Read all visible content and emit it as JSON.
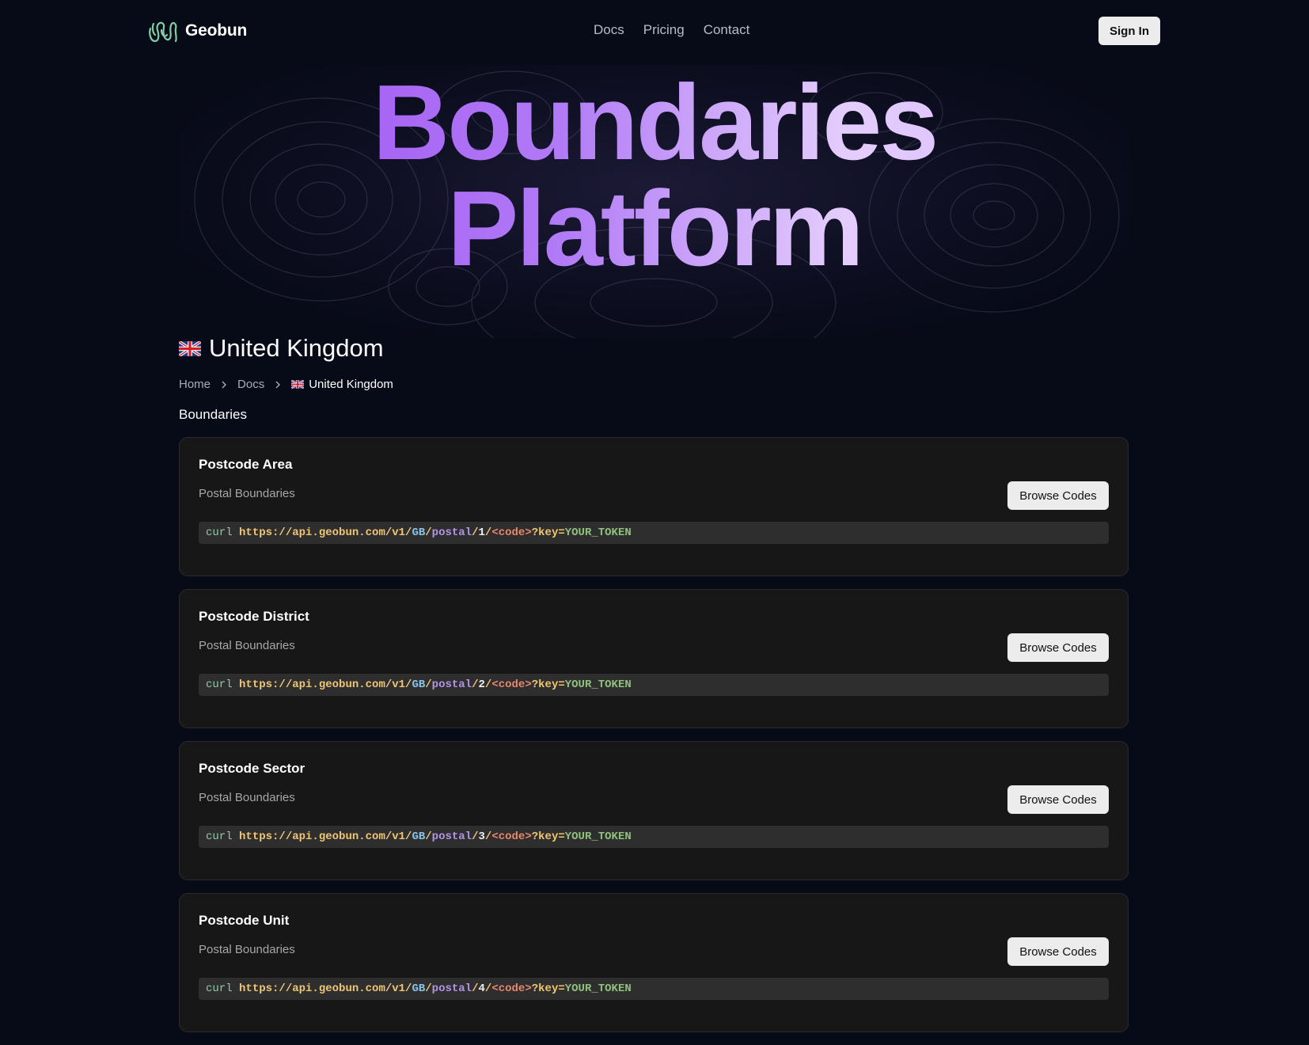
{
  "nav": {
    "brand": "Geobun",
    "links": [
      "Docs",
      "Pricing",
      "Contact"
    ],
    "sign_in": "Sign In"
  },
  "hero": {
    "line1": "Boundaries",
    "line2": "Platform"
  },
  "country": {
    "flag_icon": "uk-flag-icon",
    "name": "United Kingdom"
  },
  "breadcrumb": {
    "home": "Home",
    "docs": "Docs",
    "current": "United Kingdom"
  },
  "section_label": "Boundaries",
  "cards": [
    {
      "title": "Postcode Area",
      "subtitle": "Postal Boundaries",
      "button": "Browse Codes",
      "code": {
        "cmd": "curl",
        "base": "https://api.geobun.com/v1/",
        "country": "GB",
        "sep1": "/",
        "type": "postal",
        "sep2": "/",
        "level": "1",
        "sep3": "/",
        "placeholder": "<code>",
        "query": "?key=",
        "token": "YOUR_TOKEN"
      }
    },
    {
      "title": "Postcode District",
      "subtitle": "Postal Boundaries",
      "button": "Browse Codes",
      "code": {
        "cmd": "curl",
        "base": "https://api.geobun.com/v1/",
        "country": "GB",
        "sep1": "/",
        "type": "postal",
        "sep2": "/",
        "level": "2",
        "sep3": "/",
        "placeholder": "<code>",
        "query": "?key=",
        "token": "YOUR_TOKEN"
      }
    },
    {
      "title": "Postcode Sector",
      "subtitle": "Postal Boundaries",
      "button": "Browse Codes",
      "code": {
        "cmd": "curl",
        "base": "https://api.geobun.com/v1/",
        "country": "GB",
        "sep1": "/",
        "type": "postal",
        "sep2": "/",
        "level": "3",
        "sep3": "/",
        "placeholder": "<code>",
        "query": "?key=",
        "token": "YOUR_TOKEN"
      }
    },
    {
      "title": "Postcode Unit",
      "subtitle": "Postal Boundaries",
      "button": "Browse Codes",
      "code": {
        "cmd": "curl",
        "base": "https://api.geobun.com/v1/",
        "country": "GB",
        "sep1": "/",
        "type": "postal",
        "sep2": "/",
        "level": "4",
        "sep3": "/",
        "placeholder": "<code>",
        "query": "?key=",
        "token": "YOUR_TOKEN"
      }
    }
  ]
}
